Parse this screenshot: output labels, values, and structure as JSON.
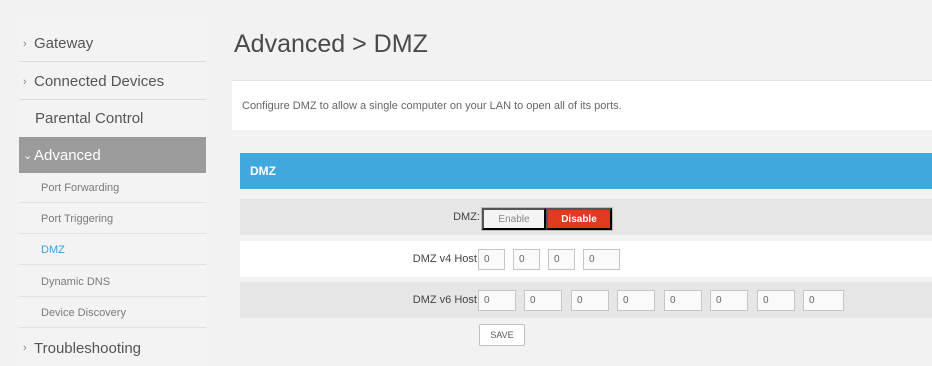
{
  "sidebar": {
    "items": [
      {
        "label": "Gateway",
        "arrow": "›"
      },
      {
        "label": "Connected Devices",
        "arrow": "›"
      },
      {
        "label": "Parental Control",
        "arrow": ""
      },
      {
        "label": "Advanced",
        "arrow": "⌄"
      },
      {
        "label": "Troubleshooting",
        "arrow": "›"
      }
    ],
    "sub_items": [
      {
        "label": "Port Forwarding"
      },
      {
        "label": "Port Triggering"
      },
      {
        "label": "DMZ"
      },
      {
        "label": "Dynamic DNS"
      },
      {
        "label": "Device Discovery"
      }
    ]
  },
  "main": {
    "title": "Advanced > DMZ",
    "intro": "Configure DMZ to allow a single computer on your LAN to open all of its ports.",
    "panel_title": "DMZ",
    "dmz_label": "DMZ:",
    "enable_label": "Enable",
    "disable_label": "Disable",
    "v4_label": "DMZ v4 Host:",
    "v4_values": [
      "0",
      "0",
      "0",
      "0"
    ],
    "v6_label": "DMZ v6 Host:",
    "v6_values": [
      "0",
      "0",
      "0",
      "0",
      "0",
      "0",
      "0",
      "0"
    ],
    "save_label": "SAVE"
  },
  "colors": {
    "accent": "#41a8de",
    "active_nav": "#9b9b9b",
    "disable_red": "#e23a1f",
    "current_link": "#3aa1d8"
  }
}
